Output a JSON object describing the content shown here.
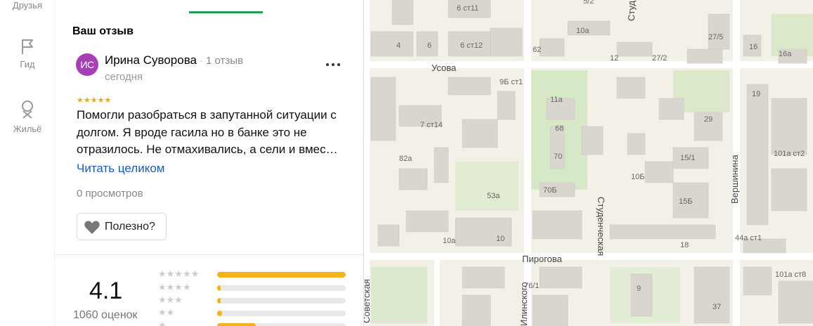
{
  "nav": {
    "friends_label": "Друзья",
    "guide_label": "Гид",
    "housing_label": "Жильё"
  },
  "panel": {
    "section_title": "Ваш отзыв"
  },
  "review": {
    "avatar_initials": "ИС",
    "avatar_color": "#a83eb4",
    "author_name": "Ирина Суворова",
    "separator": "·",
    "author_reviews": "1 отзыв",
    "date": "сегодня",
    "stars": "★★★★★",
    "rating": 5,
    "text": "Помогли разобраться в запутанной ситуации с долгом. Я вроде гасила но в банке это не отразилось. Не отмахивались, а сели и вмес…",
    "read_more": "Читать целиком",
    "views": "0 просмотров",
    "useful_label": "Полезно?"
  },
  "rating_summary": {
    "value": "4.1",
    "count_label": "1060 оценок",
    "distribution": [
      {
        "stars": "★★★★★",
        "fraction": 1.0
      },
      {
        "stars": "★★★★",
        "fraction": 0.03
      },
      {
        "stars": "★★★",
        "fraction": 0.03
      },
      {
        "stars": "★★",
        "fraction": 0.04
      },
      {
        "stars": "★",
        "fraction": 0.3
      }
    ]
  },
  "map": {
    "streets": [
      "Усова",
      "Пирогова",
      "Студенческая",
      "Вершинина",
      "Студ",
      "Советская",
      "Илинского"
    ],
    "house_labels": [
      "6 ст11",
      "4",
      "6",
      "6 ст12",
      "10а",
      "62",
      "12",
      "27/2",
      "27/5",
      "16",
      "16а",
      "9Б ст1",
      "11а",
      "7 ст14",
      "68",
      "19",
      "29",
      "82а",
      "70",
      "10Б",
      "15/1",
      "101а ст2",
      "70Б",
      "53а",
      "15Б",
      "10а",
      "10",
      "18",
      "44а ст1",
      "101а ст8",
      "76/1",
      "9",
      "37",
      "5/2"
    ]
  }
}
